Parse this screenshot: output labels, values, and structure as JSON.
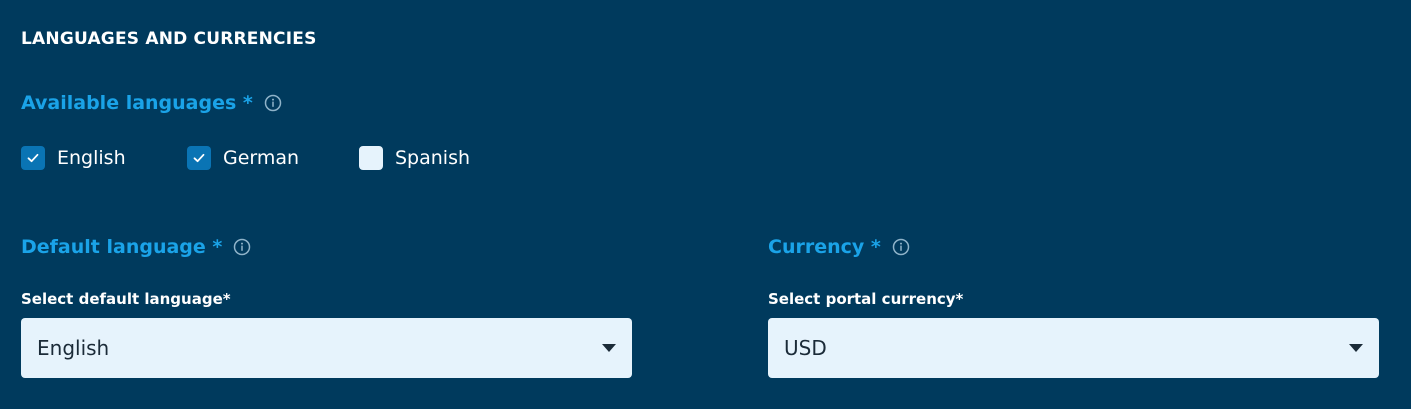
{
  "section": {
    "title": "LANGUAGES AND CURRENCIES"
  },
  "available_languages": {
    "label": "Available languages *",
    "options": [
      {
        "label": "English",
        "checked": true
      },
      {
        "label": "German",
        "checked": true
      },
      {
        "label": "Spanish",
        "checked": false
      }
    ]
  },
  "default_language": {
    "label": "Default language *",
    "field_label": "Select default language*",
    "value": "English"
  },
  "currency": {
    "label": "Currency *",
    "field_label": "Select portal currency*",
    "value": "USD"
  },
  "colors": {
    "background": "#003a5d",
    "accent": "#1aa3e8",
    "checkbox_checked": "#0a74b4",
    "select_bg": "#e6f3fc"
  },
  "icons": {
    "info": "info-icon",
    "check": "check-icon",
    "dropdown": "caret-down-icon"
  }
}
